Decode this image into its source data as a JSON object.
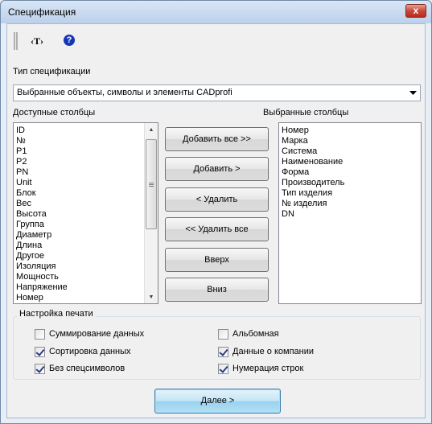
{
  "window": {
    "title": "Спецификация",
    "close_label": "x"
  },
  "toolbar": {
    "t_label": "‹T›",
    "help_label": "?"
  },
  "spec_type": {
    "label": "Тип спецификации",
    "selected": "Выбранные объекты, символы и элементы CADprofi"
  },
  "available": {
    "label": "Доступные столбцы",
    "items": [
      "ID",
      "№",
      "P1",
      "P2",
      "PN",
      "Unit",
      "Блок",
      "Вес",
      "Высота",
      "Группа",
      "Диаметр",
      "Длина",
      "Другое",
      "Изоляция",
      "Мощность",
      "Напряжение",
      "Номер"
    ]
  },
  "selected": {
    "label": "Выбранные столбцы",
    "items": [
      "Номер",
      "Марка",
      "Система",
      "Наименование",
      "Форма",
      "Производитель",
      "Тип изделия",
      "№ изделия",
      "DN"
    ]
  },
  "buttons": {
    "add_all": "Добавить все >>",
    "add": "Добавить >",
    "remove": "< Удалить",
    "remove_all": "<< Удалить все",
    "up": "Вверх",
    "down": "Вниз",
    "next": "Далее >"
  },
  "print_settings": {
    "title": "Настройка печати",
    "options": [
      {
        "label": "Суммирование данных",
        "checked": false
      },
      {
        "label": "Сортировка данных",
        "checked": true
      },
      {
        "label": "Без спецсимволов",
        "checked": true
      },
      {
        "label": "Альбомная",
        "checked": false
      },
      {
        "label": "Данные о компании",
        "checked": true
      },
      {
        "label": "Нумерация строк",
        "checked": true
      }
    ]
  }
}
